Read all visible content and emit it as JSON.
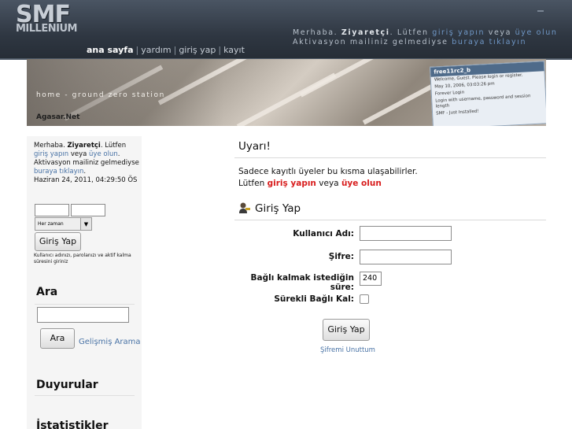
{
  "header": {
    "logo_top": "SMF",
    "logo_bottom": "MILLENIUM",
    "welcome_hello": "Merhaba.",
    "welcome_user": "Ziyaretçi",
    "welcome_please": ". Lütfen",
    "welcome_login": "giriş yapın",
    "welcome_or": "veya",
    "welcome_register": "üye olun",
    "welcome_line2": "Aktivasyon mailiniz gelmediyse",
    "welcome_click": "buraya tıklayın",
    "menu": [
      "ana sayfa",
      "yardım",
      "giriş yap",
      "kayıt"
    ]
  },
  "banner": {
    "home_text": "home - ground zero station",
    "site_name": "Agasar.Net",
    "mini_title": "free11rc2_b",
    "mini_lines": [
      "Welcome, Guest. Please login or register.",
      "May 10, 2006, 03:03:26 pm",
      "Forever  Login",
      "Login with username, password and session length",
      "SMF - Just Installed!"
    ]
  },
  "sidebar": {
    "hello": "Merhaba.",
    "user": "Ziyaretçi",
    "please": ". Lütfen",
    "login_link": "giriş yapın",
    "or": "veya",
    "register_link": "üye olun",
    "activation": "Aktivasyon mailiniz gelmediyse",
    "click_here": "buraya tıklayın",
    "datetime": "Haziran 24, 2011, 04:29:50 ÖS",
    "session_select": "Her zaman",
    "login_button": "Giriş Yap",
    "small_note": "Kullanıcı adınızı, parolanızı ve aktif kalma süresini giriniz",
    "search_heading": "Ara",
    "search_button": "Ara",
    "advanced_search": "Gelişmiş Arama",
    "news_heading": "Duyurular",
    "stats_heading": "İstatistikler"
  },
  "main": {
    "warning_title": "Uyarı!",
    "message_line1": "Sadece kayıtlı üyeler bu kısma ulaşabilirler.",
    "message_please": "Lütfen",
    "message_login": "giriş yapın",
    "message_or": "veya",
    "message_register": "üye olun",
    "login_title": "Giriş Yap",
    "username_label": "Kullanıcı Adı:",
    "password_label": "Şifre:",
    "session_label": "Bağlı kalmak istediğin süre:",
    "session_value": "240",
    "always_label": "Sürekli Bağlı Kal:",
    "login_button": "Giriş Yap",
    "forgot_link": "Şifremi Unuttum"
  }
}
